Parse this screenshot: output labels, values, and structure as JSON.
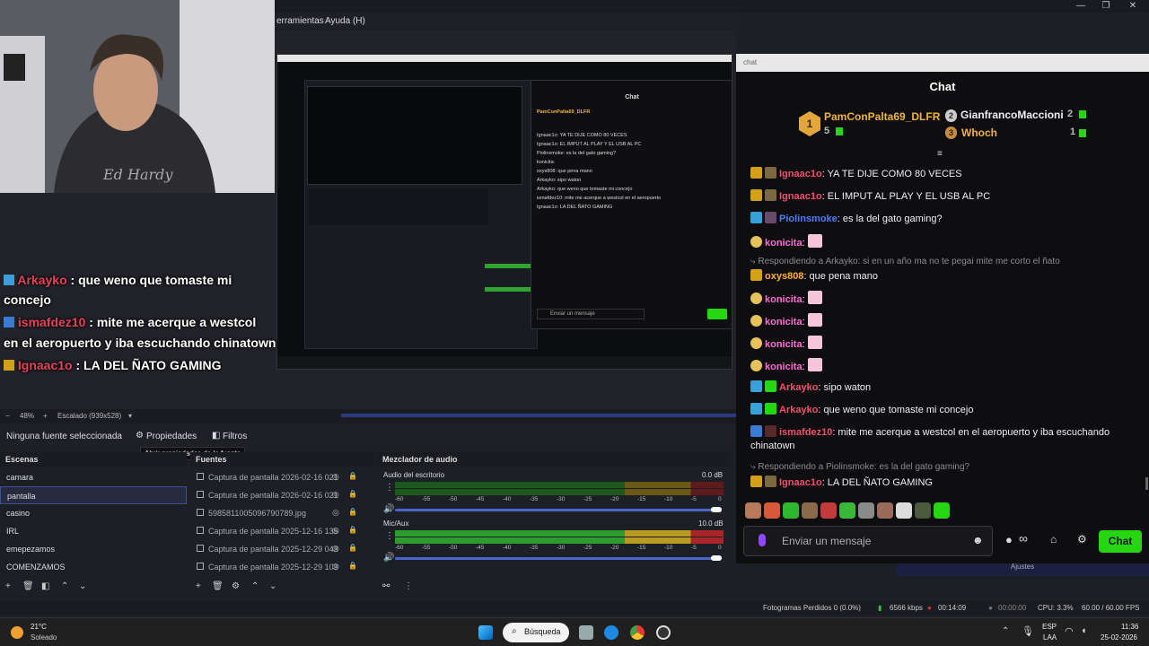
{
  "menu": {
    "tools": "erramientas",
    "help": "Ayuda (H)"
  },
  "overlay_chat": [
    {
      "user": "Arkayko",
      "text": " : que weno que tomaste mi"
    },
    {
      "user": "",
      "text": "concejo"
    },
    {
      "user": "ismafdez10",
      "text": " : mite me acerque a westcol"
    },
    {
      "user": "",
      "text": "en el aeropuerto y iba escuchando chinatown"
    },
    {
      "user": "Ignaac1o",
      "text": " : LA DEL ÑATO GAMING"
    }
  ],
  "zoom": {
    "percent": "48%",
    "scale": "Escalado (939x528)"
  },
  "source_bar": {
    "no_source": "Ninguna fuente seleccionada",
    "properties": "Propiedades",
    "filters": "Filtros",
    "tooltip": "Abrir propiedades de la fuente"
  },
  "scenes": {
    "title": "Escenas",
    "items": [
      "camara",
      "pantalla",
      "casino",
      "IRL",
      "emepezamos",
      "COMENZAMOS"
    ],
    "selected": "pantalla"
  },
  "sources": {
    "title": "Fuentes",
    "items": [
      "Captura de pantalla 2026-02-16 021",
      "Captura de pantalla 2026-02-16 021",
      "5985811005096790789.jpg",
      "Captura de pantalla 2025-12-16 135",
      "Captura de pantalla 2025-12-29 043",
      "Captura de pantalla 2025-12-29 103"
    ]
  },
  "mixer": {
    "title": "Mezclador de audio",
    "tracks": [
      {
        "name": "Audio del escritorio",
        "db": "0.0 dB",
        "level": 0.0
      },
      {
        "name": "Mic/Aux",
        "db": "10.0 dB",
        "level": 1.0
      }
    ],
    "scale": [
      "-60",
      "-55",
      "-50",
      "-45",
      "-40",
      "-35",
      "-30",
      "-25",
      "-20",
      "-15",
      "-10",
      "-5",
      "0"
    ]
  },
  "status": {
    "dropped": "Fotogramas Perdidos 0 (0.0%)",
    "bitrate": "6566 kbps",
    "rec_time": "00:14:09",
    "stream_time": "00:00:00",
    "cpu": "CPU: 3.3%",
    "fps": "60.00 / 60.00 FPS"
  },
  "taskbar": {
    "temp": "21°C",
    "weather": "Soleado",
    "search": "Búsqueda",
    "lang": "ESP",
    "lang2": "LAA",
    "time": "11:36",
    "date": "25-02-2026"
  },
  "chat": {
    "window_label": "chat",
    "title": "Chat",
    "leaderboard": [
      {
        "rank": "1",
        "name": "PamConPalta69_DLFR",
        "count": "5"
      },
      {
        "rank": "2",
        "name": "GianfrancoMaccioni",
        "count": "2"
      },
      {
        "rank": "3",
        "name": "Whoch",
        "count": "1"
      }
    ],
    "messages": [
      {
        "user": "Ignaac1o",
        "text": ": YA TE DIJE COMO 80 VECES",
        "color": "#f0506e"
      },
      {
        "user": "Ignaac1o",
        "text": ": EL IMPUT AL PLAY Y EL USB AL PC",
        "color": "#f0506e"
      },
      {
        "user": "Piolinsmoke",
        "text": ": es la del gato gaming?",
        "color": "#4a7cff"
      },
      {
        "user": "konicita",
        "text": ":",
        "color": "#ff6bd5"
      },
      {
        "reply": "Respondiendo a Arkayko: si en un año ma no te pegai mite me corto el ñato"
      },
      {
        "user": "oxys808",
        "text": ": que pena mano",
        "color": "#ffb02a"
      },
      {
        "user": "konicita",
        "text": ":",
        "color": "#ff6bd5"
      },
      {
        "user": "konicita",
        "text": ":",
        "color": "#ff6bd5"
      },
      {
        "user": "konicita",
        "text": ":",
        "color": "#ff6bd5"
      },
      {
        "user": "konicita",
        "text": ":",
        "color": "#ff6bd5"
      },
      {
        "user": "Arkayko",
        "text": ": sipo waton",
        "color": "#f0506e"
      },
      {
        "user": "Arkayko",
        "text": ": que weno que tomaste mi concejo",
        "color": "#f0506e"
      },
      {
        "user": "ismafdez10",
        "text": ": mite me acerque a westcol en el aeropuerto y iba escuchando",
        "color": "#f0506e"
      },
      {
        "cont": "chinatown"
      },
      {
        "reply": "Respondiendo a Piolinsmoke: es la del gato gaming?"
      },
      {
        "user": "Ignaac1o",
        "text": ": LA DEL ÑATO GAMING",
        "color": "#f0506e"
      }
    ],
    "input_placeholder": "Enviar un mensaje",
    "send_label": "Chat",
    "infinity": "∞",
    "under_label": "Ajustes"
  },
  "inner_preview": {
    "chat_title": "Chat",
    "lines": [
      "PamConPalta69_DLFR",
      "Ignaac1o: YA TE DIJE COMO 80 VECES",
      "Ignaac1o: EL IMPUT AL PLAY Y EL USB AL PC",
      "Piolinsmoke: es la del gato gaming?",
      "konicita:",
      "oxys808: que pena mano",
      "Arkayko: sipo waton",
      "Arkayko: que weno que tomaste mi concejo",
      "ismafdez10: mite me acerque a westcol en el aeropuerto",
      "Ignaac1o: LA DEL ÑATO GAMING"
    ],
    "input": "Enviar un mensaje"
  }
}
